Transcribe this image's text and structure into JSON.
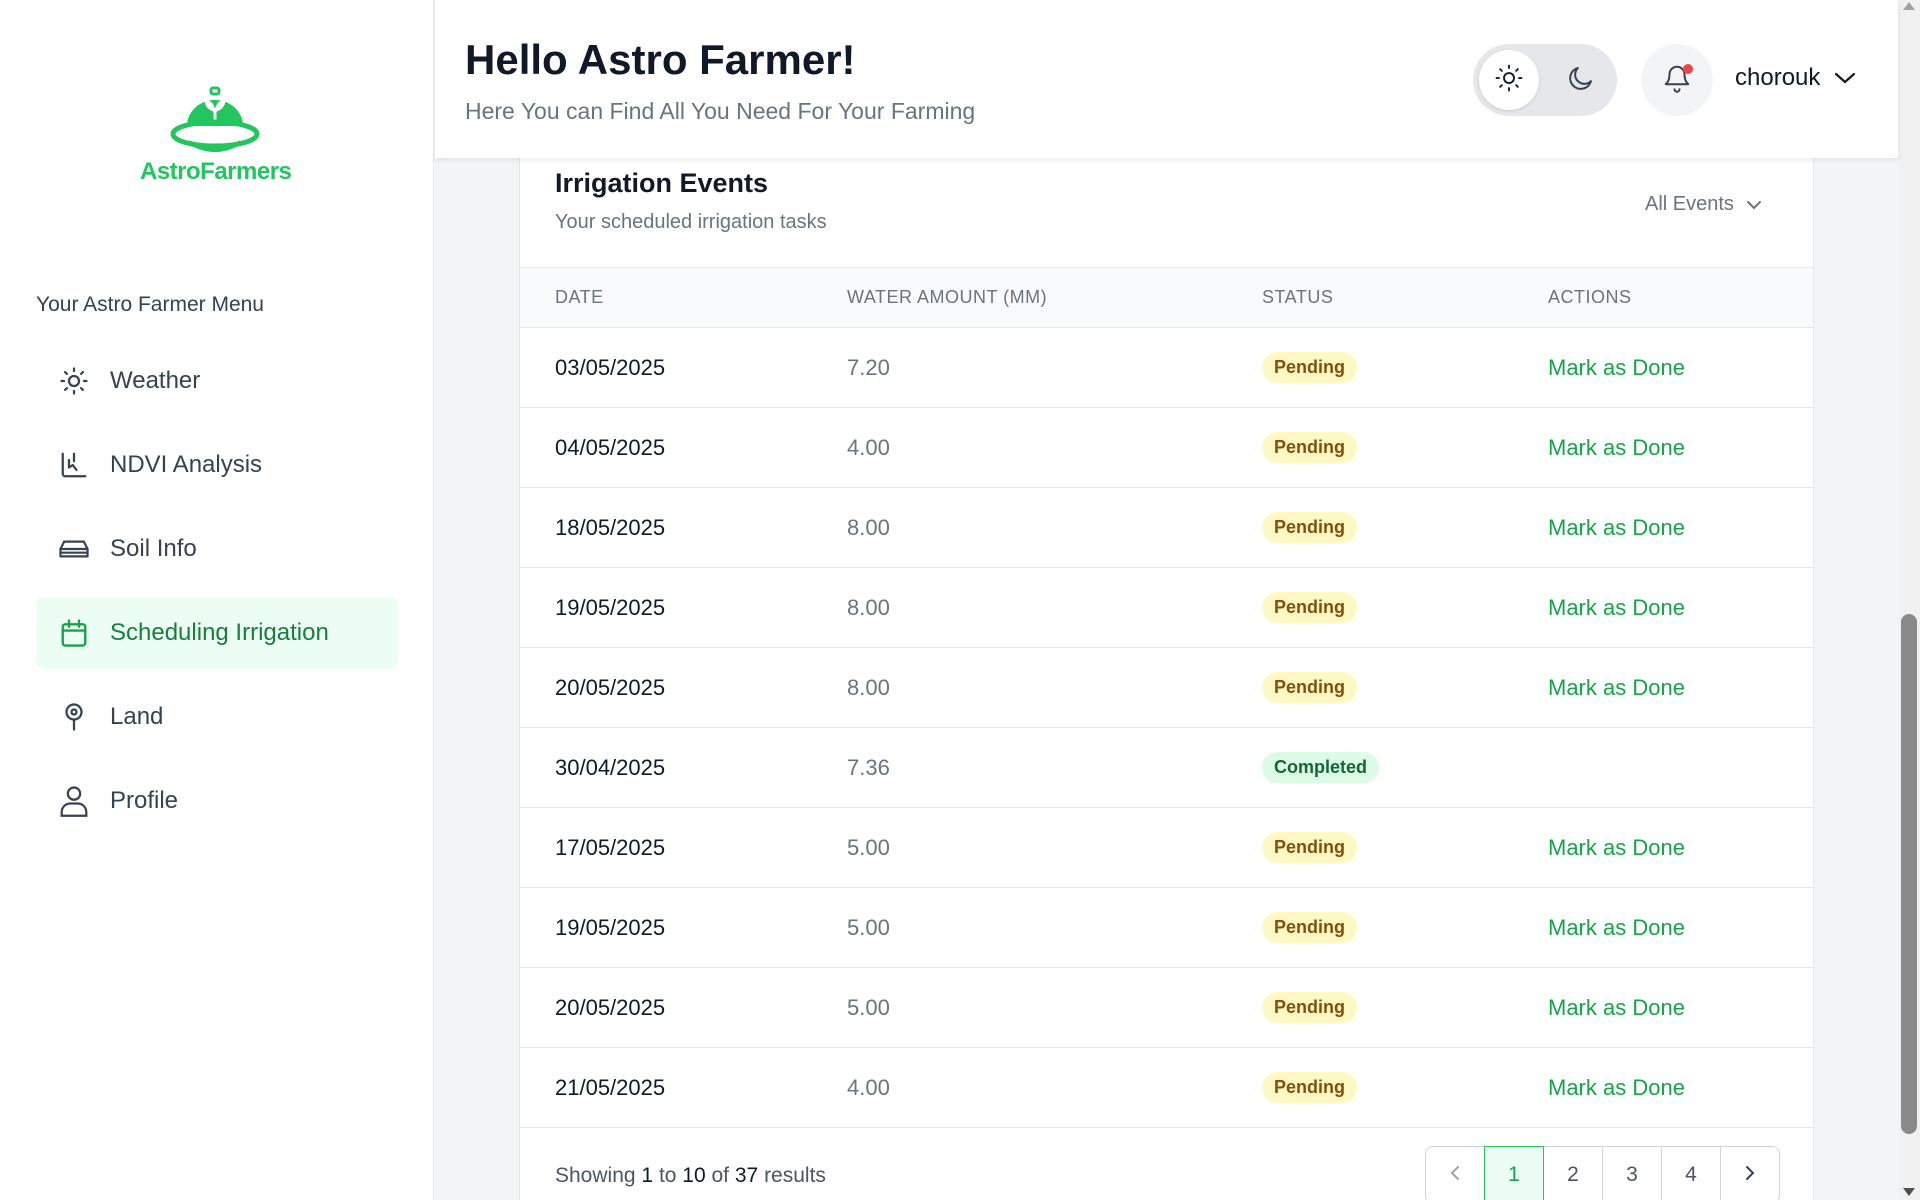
{
  "brand": {
    "name": "AstroFarmers",
    "color": "#22c55e"
  },
  "sidebar": {
    "menu_title": "Your Astro Farmer Menu",
    "items": [
      {
        "label": "Weather",
        "icon": "sun-icon"
      },
      {
        "label": "NDVI Analysis",
        "icon": "chart-icon"
      },
      {
        "label": "Soil Info",
        "icon": "layers-icon"
      },
      {
        "label": "Scheduling Irrigation",
        "icon": "calendar-icon",
        "active": true
      },
      {
        "label": "Land",
        "icon": "map-pin-icon"
      },
      {
        "label": "Profile",
        "icon": "user-icon"
      }
    ]
  },
  "header": {
    "greeting": "Hello Astro Farmer!",
    "subtitle": "Here You can Find All You Need For Your Farming",
    "theme": "light",
    "username": "chorouk",
    "has_notification": true
  },
  "card": {
    "title": "Irrigation Events",
    "subtitle": "Your scheduled irrigation tasks",
    "filter": "All Events",
    "columns": [
      "DATE",
      "WATER AMOUNT (MM)",
      "STATUS",
      "ACTIONS"
    ],
    "rows": [
      {
        "date": "03/05/2025",
        "amount": "7.20",
        "status": "Pending",
        "action": "Mark as Done"
      },
      {
        "date": "04/05/2025",
        "amount": "4.00",
        "status": "Pending",
        "action": "Mark as Done"
      },
      {
        "date": "18/05/2025",
        "amount": "8.00",
        "status": "Pending",
        "action": "Mark as Done"
      },
      {
        "date": "19/05/2025",
        "amount": "8.00",
        "status": "Pending",
        "action": "Mark as Done"
      },
      {
        "date": "20/05/2025",
        "amount": "8.00",
        "status": "Pending",
        "action": "Mark as Done"
      },
      {
        "date": "30/04/2025",
        "amount": "7.36",
        "status": "Completed",
        "action": ""
      },
      {
        "date": "17/05/2025",
        "amount": "5.00",
        "status": "Pending",
        "action": "Mark as Done"
      },
      {
        "date": "19/05/2025",
        "amount": "5.00",
        "status": "Pending",
        "action": "Mark as Done"
      },
      {
        "date": "20/05/2025",
        "amount": "5.00",
        "status": "Pending",
        "action": "Mark as Done"
      },
      {
        "date": "21/05/2025",
        "amount": "4.00",
        "status": "Pending",
        "action": "Mark as Done"
      }
    ],
    "pagination": {
      "prefix": "Showing",
      "from": "1",
      "to_word": "to",
      "to": "10",
      "of_word": "of",
      "total": "37",
      "suffix": "results",
      "pages": [
        "1",
        "2",
        "3",
        "4"
      ],
      "current": "1"
    }
  },
  "colors": {
    "accent": "#16a34a",
    "pending_bg": "#fef9c3",
    "completed_bg": "#dcfce7"
  }
}
